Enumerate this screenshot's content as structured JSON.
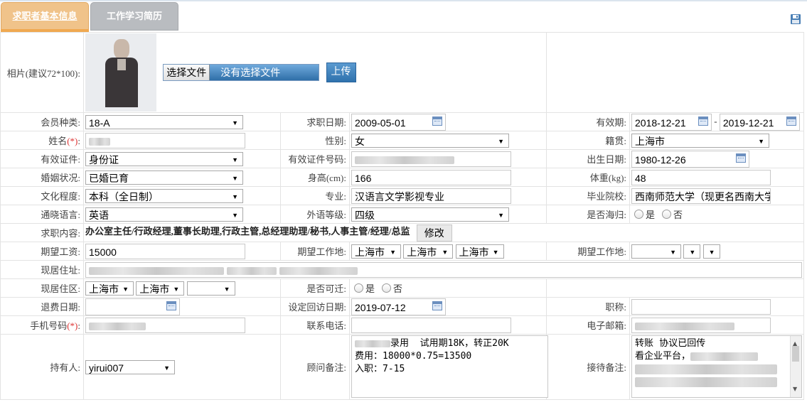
{
  "tabs": [
    {
      "label": "求职者基本信息"
    },
    {
      "label": "工作学习简历"
    }
  ],
  "icons": {
    "save": "save-icon",
    "calendar": "calendar-icon"
  },
  "photo": {
    "label": "相片(建议72*100):",
    "choose_file": "选择文件",
    "no_file": "没有选择文件",
    "upload": "上传"
  },
  "fields": {
    "member_type": {
      "label": "会员种类:",
      "value": "18-A"
    },
    "job_date": {
      "label": "求职日期:",
      "value": "2009-05-01"
    },
    "valid_period": {
      "label": "有效期:",
      "from": "2018-12-21",
      "sep": "-",
      "to": "2019-12-21"
    },
    "name": {
      "label": "姓名",
      "required": "(*)",
      "colon": ":"
    },
    "gender": {
      "label": "性别:",
      "value": "女"
    },
    "native_place": {
      "label": "籍贯:",
      "value": "上海市"
    },
    "id_type": {
      "label": "有效证件:",
      "value": "身份证"
    },
    "id_number": {
      "label": "有效证件号码:"
    },
    "birth_date": {
      "label": "出生日期:",
      "value": "1980-12-26"
    },
    "marital": {
      "label": "婚姻状况:",
      "value": "已婚已育"
    },
    "height": {
      "label": "身高(cm):",
      "value": "166"
    },
    "weight": {
      "label": "体重(kg):",
      "value": "48"
    },
    "education": {
      "label": "文化程度:",
      "value": "本科（全日制）"
    },
    "major": {
      "label": "专业:",
      "value": "汉语言文学影视专业"
    },
    "school": {
      "label": "毕业院校:",
      "value": "西南师范大学（现更名西南大学）"
    },
    "language": {
      "label": "通晓语言:",
      "value": "英语"
    },
    "language_level": {
      "label": "外语等级:",
      "value": "四级"
    },
    "returnee": {
      "label": "是否海归:",
      "yes": "是",
      "no": "否"
    },
    "job_content": {
      "label": "求职内容:",
      "value": "办公室主任/行政经理,董事长助理,行政主管,总经理助理/秘书,人事主管/经理/总监",
      "edit": "修改"
    },
    "salary": {
      "label": "期望工资:",
      "value": "15000"
    },
    "work_place": {
      "label": "期望工作地:",
      "v1": "上海市",
      "v2": "上海市",
      "v3": "上海市"
    },
    "work_place2": {
      "label": "期望工作地:"
    },
    "address": {
      "label": "现居住址:"
    },
    "area": {
      "label": "现居住区:",
      "v1": "上海市",
      "v2": "上海市"
    },
    "relocate": {
      "label": "是否可迁:",
      "yes": "是",
      "no": "否"
    },
    "refund_date": {
      "label": "退费日期:"
    },
    "callback_date": {
      "label": "设定回访日期:",
      "value": "2019-07-12"
    },
    "title": {
      "label": "职称:"
    },
    "mobile": {
      "label": "手机号码",
      "required": "(*)",
      "colon": ":"
    },
    "phone": {
      "label": "联系电话:"
    },
    "email": {
      "label": "电子邮箱:"
    },
    "holder": {
      "label": "持有人:",
      "value": "yirui007"
    },
    "advisor_note": {
      "label": "顾问备注:",
      "line1": "录用  试用期18K，转正20K",
      "line2": "费用：18000*0.75=13500",
      "line3": "入职：7-15"
    },
    "reception_note": {
      "label": "接待备注:",
      "line1": "转账  协议已回传",
      "line2": "看企业平台，"
    }
  }
}
